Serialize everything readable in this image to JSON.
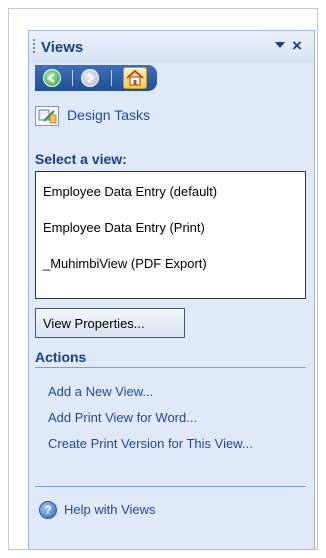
{
  "pane": {
    "title": "Views",
    "toolbar": {
      "buttons": [
        {
          "icon": "back-arrow-icon",
          "color": "#2e9a3a"
        },
        {
          "icon": "forward-arrow-icon",
          "color": "#a9b8cc"
        },
        {
          "icon": "home-icon",
          "color": "#ffc84a"
        }
      ]
    },
    "accent_color": "#15428b",
    "link_color": "#1f4aa2",
    "background_color": "#dfe9f7"
  },
  "design_tasks": {
    "label": "Design Tasks",
    "icon": "design-tasks-icon"
  },
  "select_view": {
    "header": "Select a view:",
    "views": [
      {
        "label": "Employee Data Entry (default)"
      },
      {
        "label": "Employee Data Entry (Print)"
      },
      {
        "label": "_MuhimbiView (PDF Export)"
      }
    ],
    "properties_button": "View Properties..."
  },
  "actions": {
    "header": "Actions",
    "links": [
      {
        "label": "Add a New View..."
      },
      {
        "label": "Add Print View for Word..."
      },
      {
        "label": "Create Print Version for This View..."
      }
    ]
  },
  "help": {
    "label": "Help with Views",
    "icon": "help-icon"
  }
}
